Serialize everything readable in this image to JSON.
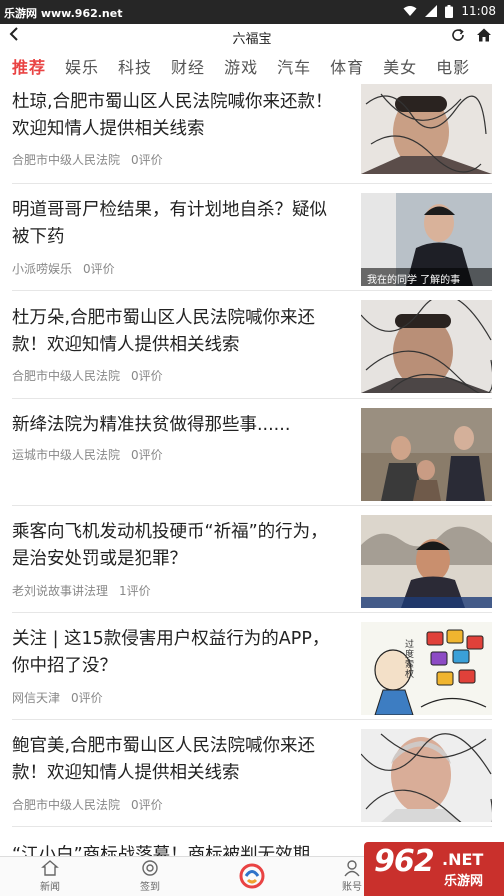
{
  "status": {
    "site": "乐游网 www.962.net",
    "time": "11:08"
  },
  "titlebar": {
    "title": "六福宝"
  },
  "tabs": [
    "推荐",
    "娱乐",
    "科技",
    "财经",
    "游戏",
    "汽车",
    "体育",
    "美女",
    "电影"
  ],
  "news": [
    {
      "title": "杜琼,合肥市蜀山区人民法院喊你来还款！欢迎知情人提供相关线索",
      "source": "合肥市中级人民法院",
      "comments": "0评价"
    },
    {
      "title": "明道哥哥尸检结果，有计划地自杀？疑似被下药",
      "source": "小派唠娱乐",
      "comments": "0评价",
      "caption": "我在的同学 了解的事"
    },
    {
      "title": "杜万朵,合肥市蜀山区人民法院喊你来还款！欢迎知情人提供相关线索",
      "source": "合肥市中级人民法院",
      "comments": "0评价"
    },
    {
      "title": "新绛法院为精准扶贫做得那些事......",
      "source": "运城市中级人民法院",
      "comments": "0评价"
    },
    {
      "title": "乘客向飞机发动机投硬币“祈福”的行为，是治安处罚或是犯罪？",
      "source": "老刘说故事讲法理",
      "comments": "1评价"
    },
    {
      "title": "关注 | 这15款侵害用户权益行为的APP，你中招了没？",
      "source": "网信天津",
      "comments": "0评价",
      "caption": "过度索权"
    },
    {
      "title": "鲍官美,合肥市蜀山区人民法院喊你来还款！欢迎知情人提供相关线索",
      "source": "合肥市中级人民法院",
      "comments": "0评价"
    },
    {
      "title": "“江小白”商标战落幕！商标被判无效期",
      "source": "",
      "comments": ""
    }
  ],
  "bottom_nav": {
    "news": "新闻",
    "checkin": "签到",
    "account": "账号"
  },
  "watermark": {
    "big": "962",
    "net": ".NET",
    "cn": "乐游网"
  }
}
